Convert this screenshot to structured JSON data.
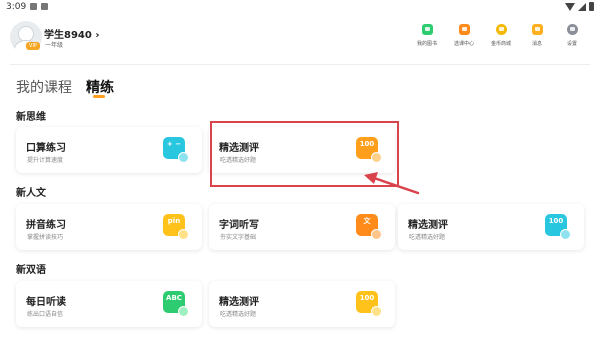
{
  "status_bar": {
    "time": "3:09"
  },
  "profile": {
    "name": "学生8940",
    "chevron": "›",
    "grade": "一年级",
    "badge": "VIP"
  },
  "top_menu": [
    {
      "label": "我的图书",
      "icon": "book-icon",
      "color": "#2ecc71"
    },
    {
      "label": "选课中心",
      "icon": "course-icon",
      "color": "#ff8c1a"
    },
    {
      "label": "金币商城",
      "icon": "coin-icon",
      "color": "#f5b800"
    },
    {
      "label": "消息",
      "icon": "message-icon",
      "color": "#ffb020"
    },
    {
      "label": "设置",
      "icon": "gear-icon",
      "color": "#8a8f98"
    }
  ],
  "tabs": [
    {
      "label": "我的课程",
      "active": false
    },
    {
      "label": "精练",
      "active": true
    }
  ],
  "sections": [
    {
      "title": "新思维",
      "cards": [
        {
          "title": "口算练习",
          "subtitle": "提升计算速度",
          "icon": "math-icon",
          "icon_text": "+ −",
          "color": "#29c6e0"
        },
        {
          "title": "精选测评",
          "subtitle": "吃透精选好题",
          "icon": "score-100-icon",
          "icon_text": "100",
          "color": "#ff9f1c"
        }
      ]
    },
    {
      "title": "新人文",
      "cards": [
        {
          "title": "拼音练习",
          "subtitle": "掌握拼读技巧",
          "icon": "pinyin-icon",
          "icon_text": "pin",
          "color": "#ffc21a"
        },
        {
          "title": "字词听写",
          "subtitle": "夯实文字基础",
          "icon": "chinese-character-icon",
          "icon_text": "文",
          "color": "#ff8c1a"
        },
        {
          "title": "精选测评",
          "subtitle": "吃透精选好题",
          "icon": "score-100-icon",
          "icon_text": "100",
          "color": "#29c6e0"
        }
      ]
    },
    {
      "title": "新双语",
      "cards": [
        {
          "title": "每日听读",
          "subtitle": "练出口语自信",
          "icon": "abc-icon",
          "icon_text": "ABC",
          "color": "#2ecc71"
        },
        {
          "title": "精选测评",
          "subtitle": "吃透精选好题",
          "icon": "score-100-icon",
          "icon_text": "100",
          "color": "#ffc21a"
        }
      ]
    }
  ],
  "annotation": {
    "color": "#d9434b",
    "target": "新思维 精选测评"
  }
}
